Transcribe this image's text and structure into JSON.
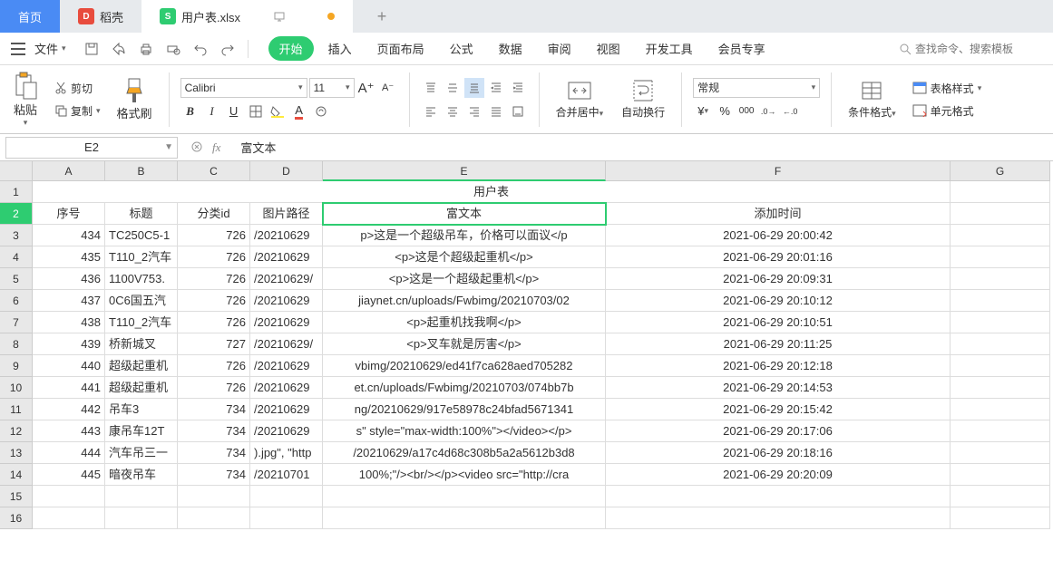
{
  "tabs": {
    "home": "首页",
    "dao": "稻壳",
    "file": "用户表.xlsx"
  },
  "menu": {
    "file": "文件",
    "tabs": [
      "开始",
      "插入",
      "页面布局",
      "公式",
      "数据",
      "审阅",
      "视图",
      "开发工具",
      "会员专享"
    ],
    "search_placeholder": "查找命令、搜索模板"
  },
  "ribbon": {
    "paste": "粘贴",
    "cut": "剪切",
    "copy": "复制",
    "fmtpaint": "格式刷",
    "font_name": "Calibri",
    "font_size": "11",
    "merge": "合并居中",
    "wrap": "自动换行",
    "numfmt": "常规",
    "condfmt": "条件格式",
    "tablestyle": "表格样式",
    "cellfmt": "单元格式"
  },
  "fx": {
    "name": "E2",
    "value": "富文本"
  },
  "cols": [
    "A",
    "B",
    "C",
    "D",
    "E",
    "F",
    "G"
  ],
  "sheet_title": "用户表",
  "headers": {
    "A": "序号",
    "B": "标题",
    "C": "分类id",
    "D": "图片路径",
    "E": "富文本",
    "F": "添加时间"
  },
  "rows": [
    {
      "r": "3",
      "A": "434",
      "B": "TC250C5-1",
      "C": "726",
      "D": "/20210629",
      "E": "p>这是一个超级吊车，价格可以面议</p",
      "F": "2021-06-29 20:00:42"
    },
    {
      "r": "4",
      "A": "435",
      "B": "T110_2汽车",
      "C": "726",
      "D": "/20210629",
      "E": "<p>这是个超级起重机</p>",
      "F": "2021-06-29 20:01:16"
    },
    {
      "r": "5",
      "A": "436",
      "B": "1100V753.",
      "C": "726",
      "D": "/20210629/",
      "E": "<p>这是一个超级起重机</p>",
      "F": "2021-06-29 20:09:31"
    },
    {
      "r": "6",
      "A": "437",
      "B": "0C6国五汽",
      "C": "726",
      "D": "/20210629",
      "E": "jiaynet.cn/uploads/Fwbimg/20210703/02",
      "F": "2021-06-29 20:10:12"
    },
    {
      "r": "7",
      "A": "438",
      "B": "T110_2汽车",
      "C": "726",
      "D": "/20210629",
      "E": "<p>起重机找我啊</p>",
      "F": "2021-06-29 20:10:51"
    },
    {
      "r": "8",
      "A": "439",
      "B": "桥新城叉",
      "C": "727",
      "D": "/20210629/",
      "E": "<p>叉车就是厉害</p>",
      "F": "2021-06-29 20:11:25"
    },
    {
      "r": "9",
      "A": "440",
      "B": "超级起重机",
      "C": "726",
      "D": "/20210629",
      "E": "vbimg/20210629/ed41f7ca628aed705282",
      "F": "2021-06-29 20:12:18"
    },
    {
      "r": "10",
      "A": "441",
      "B": "超级起重机",
      "C": "726",
      "D": "/20210629",
      "E": "et.cn/uploads/Fwbimg/20210703/074bb7b",
      "F": "2021-06-29 20:14:53"
    },
    {
      "r": "11",
      "A": "442",
      "B": "吊车3",
      "C": "734",
      "D": "/20210629",
      "E": "ng/20210629/917e58978c24bfad5671341",
      "F": "2021-06-29 20:15:42"
    },
    {
      "r": "12",
      "A": "443",
      "B": "康吊车12T",
      "C": "734",
      "D": "/20210629",
      "E": "s\" style=\"max-width:100%\"></video></p>",
      "F": "2021-06-29 20:17:06"
    },
    {
      "r": "13",
      "A": "444",
      "B": "汽车吊三一",
      "C": "734",
      "D": ").jpg\", \"http",
      "E": "/20210629/a17c4d68c308b5a2a5612b3d8",
      "F": "2021-06-29 20:18:16"
    },
    {
      "r": "14",
      "A": "445",
      "B": "暗夜吊车",
      "C": "734",
      "D": "/20210701",
      "E": "100%;\"/><br/></p><video src=\"http://cra",
      "F": "2021-06-29 20:20:09"
    }
  ],
  "empty_rows": [
    "15",
    "16"
  ]
}
